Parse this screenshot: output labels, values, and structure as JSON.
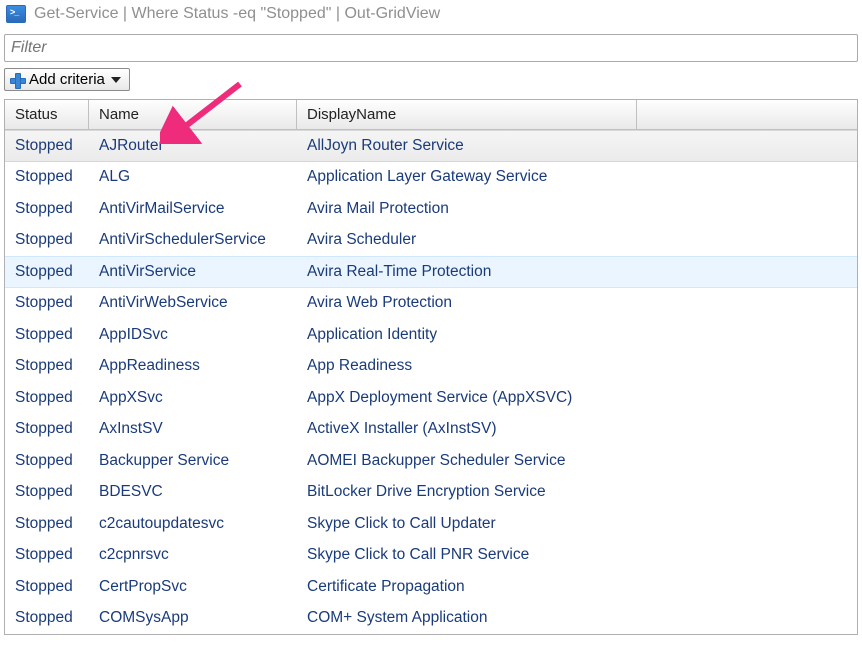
{
  "window": {
    "title": "Get-Service | Where Status -eq \"Stopped\" | Out-GridView"
  },
  "filter": {
    "placeholder": "Filter"
  },
  "criteria": {
    "add_label": "Add criteria"
  },
  "grid": {
    "columns": {
      "status": "Status",
      "name": "Name",
      "displayname": "DisplayName"
    },
    "selected_index": 0,
    "hover_index": 4,
    "rows": [
      {
        "status": "Stopped",
        "name": "AJRouter",
        "displayname": "AllJoyn Router Service"
      },
      {
        "status": "Stopped",
        "name": "ALG",
        "displayname": "Application Layer Gateway Service"
      },
      {
        "status": "Stopped",
        "name": "AntiVirMailService",
        "displayname": "Avira Mail Protection"
      },
      {
        "status": "Stopped",
        "name": "AntiVirSchedulerService",
        "displayname": "Avira Scheduler"
      },
      {
        "status": "Stopped",
        "name": "AntiVirService",
        "displayname": "Avira Real-Time Protection"
      },
      {
        "status": "Stopped",
        "name": "AntiVirWebService",
        "displayname": "Avira Web Protection"
      },
      {
        "status": "Stopped",
        "name": "AppIDSvc",
        "displayname": "Application Identity"
      },
      {
        "status": "Stopped",
        "name": "AppReadiness",
        "displayname": "App Readiness"
      },
      {
        "status": "Stopped",
        "name": "AppXSvc",
        "displayname": "AppX Deployment Service (AppXSVC)"
      },
      {
        "status": "Stopped",
        "name": "AxInstSV",
        "displayname": "ActiveX Installer (AxInstSV)"
      },
      {
        "status": "Stopped",
        "name": "Backupper Service",
        "displayname": "AOMEI Backupper Scheduler Service"
      },
      {
        "status": "Stopped",
        "name": "BDESVC",
        "displayname": "BitLocker Drive Encryption Service"
      },
      {
        "status": "Stopped",
        "name": "c2cautoupdatesvc",
        "displayname": "Skype Click to Call Updater"
      },
      {
        "status": "Stopped",
        "name": "c2cpnrsvc",
        "displayname": "Skype Click to Call PNR Service"
      },
      {
        "status": "Stopped",
        "name": "CertPropSvc",
        "displayname": "Certificate Propagation"
      },
      {
        "status": "Stopped",
        "name": "COMSysApp",
        "displayname": "COM+ System Application"
      }
    ]
  },
  "annotation": {
    "arrow_color": "#ef2b7c"
  }
}
